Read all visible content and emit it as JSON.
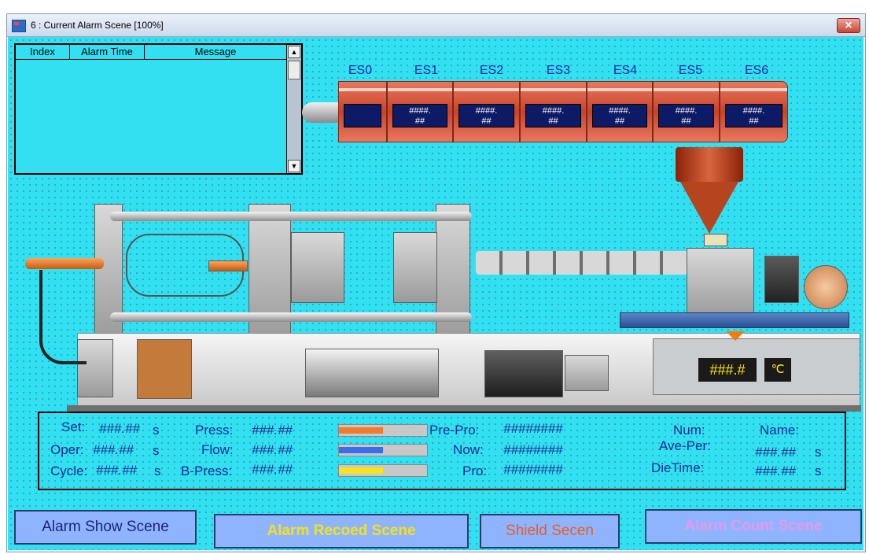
{
  "window": {
    "title": "6 : Current Alarm Scene [100%]",
    "close_glyph": "✕",
    "background_color": "#33e0f2"
  },
  "alarm_list": {
    "columns": [
      "Index",
      "Alarm Time",
      "Message"
    ],
    "rows": [],
    "scroll_up_glyph": "▲",
    "scroll_down_glyph": "▼"
  },
  "heaters": [
    {
      "label": "ES0",
      "value": ""
    },
    {
      "label": "ES1",
      "value": "####.\n##"
    },
    {
      "label": "ES2",
      "value": "####.\n##"
    },
    {
      "label": "ES3",
      "value": "####.\n##"
    },
    {
      "label": "ES4",
      "value": "####.\n##"
    },
    {
      "label": "ES5",
      "value": "####.\n##"
    },
    {
      "label": "ES6",
      "value": "####.\n##"
    }
  ],
  "oil_temp": {
    "value": "###.#",
    "unit": "℃"
  },
  "readout": {
    "set_label": "Set:",
    "set_value": "###.##",
    "set_unit": "s",
    "oper_label": "Oper:",
    "oper_value": "###.##",
    "oper_unit": "s",
    "cycle_label": "Cycle:",
    "cycle_value": "###.##",
    "cycle_unit": "s",
    "press_label": "Press:",
    "press_value": "###.##",
    "flow_label": "Flow:",
    "flow_value": "###.##",
    "bpress_label": "B-Press:",
    "bpress_value": "###.##",
    "prepro_label": "Pre-Pro:",
    "prepro_value": "########",
    "now_label": "Now:",
    "now_value": "########",
    "pro_label": "Pro:",
    "pro_value": "########",
    "num_label": "Num:",
    "name_label": "Name:",
    "aveper_label": "Ave-Per:",
    "aveper_value": "###.##",
    "aveper_unit": "s",
    "dietime_label": "DieTime:",
    "dietime_value": "###.##",
    "dietime_unit": "s",
    "bars": [
      {
        "name": "press",
        "fill_fraction": 0.5,
        "color": "#f07b2e"
      },
      {
        "name": "flow",
        "fill_fraction": 0.5,
        "color": "#3a6ee8"
      },
      {
        "name": "bpress",
        "fill_fraction": 0.5,
        "color": "#f5e51a"
      }
    ]
  },
  "buttons": {
    "alarm_show": {
      "label": "Alarm Show Scene",
      "color": "#1a237e"
    },
    "alarm_record": {
      "label": "Alarm Recoed Scene",
      "color": "#f2e21c"
    },
    "shield": {
      "label": "Shield Secen",
      "color": "#f05a1a"
    },
    "alarm_count": {
      "label": "Alarm Count Scene",
      "color": "#e39be8"
    }
  }
}
